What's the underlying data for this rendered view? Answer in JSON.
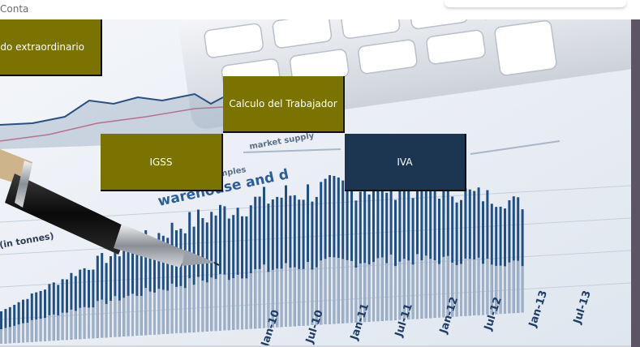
{
  "window": {
    "title": "Conta"
  },
  "tiles": {
    "sueldo": {
      "label": "Sueldo extraordinario"
    },
    "calculo": {
      "label": "Calculo del Trabajador"
    },
    "igss": {
      "label": "IGSS"
    },
    "iva": {
      "label": "IVA"
    }
  },
  "background": {
    "chart_text": [
      "(in tonnes)",
      "warehouse and d",
      "samples",
      "market supply"
    ],
    "date_labels": [
      "Jan-10",
      "Jul-10",
      "Jan-11",
      "Jul-11",
      "Jan-12",
      "Jul-12",
      "Jan-13",
      "Jul-13"
    ]
  },
  "colors": {
    "tile_olive": "#7a7300",
    "tile_navy": "#1c3550",
    "right_strip": "#5c5566"
  }
}
